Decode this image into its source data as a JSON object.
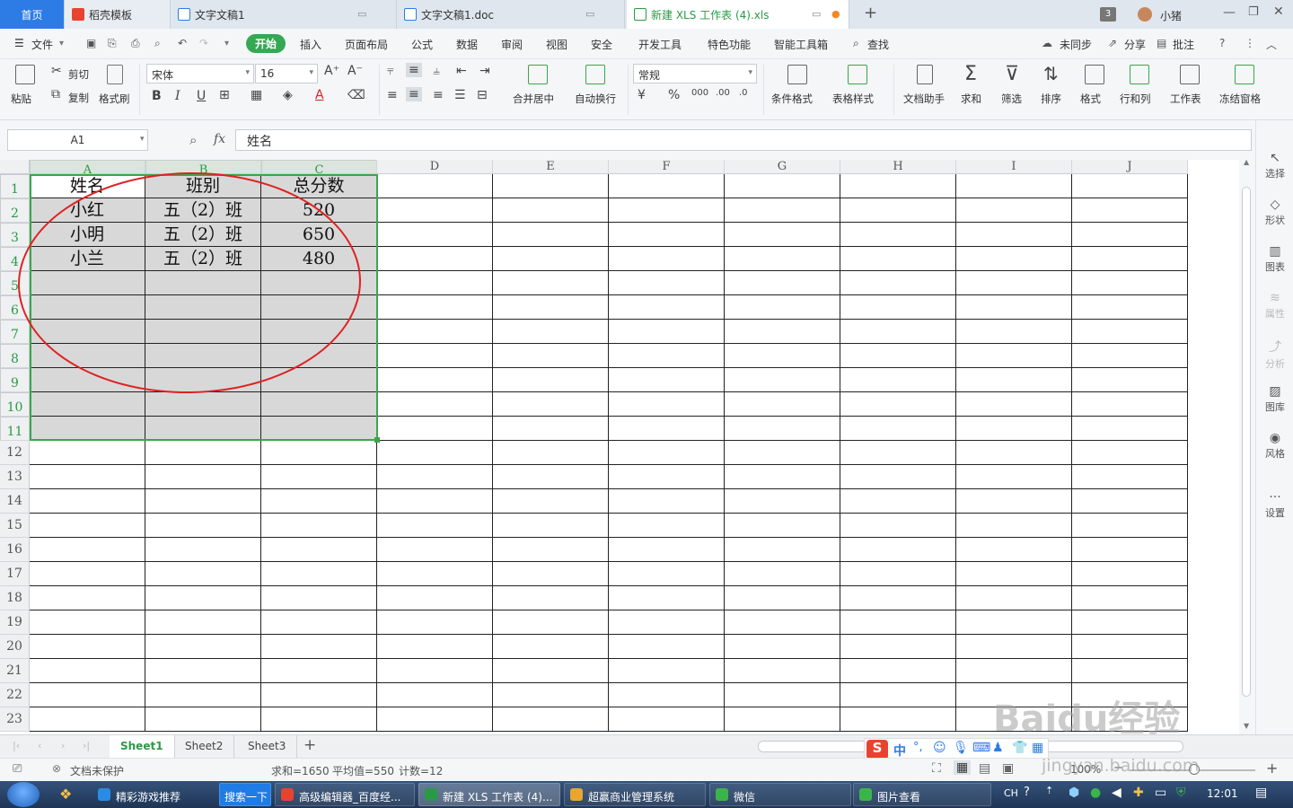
{
  "tabs": [
    {
      "label": "首页"
    },
    {
      "label": "稻壳模板"
    },
    {
      "label": "文字文稿1"
    },
    {
      "label": "文字文稿1.doc"
    },
    {
      "label": "新建 XLS 工作表 (4).xls"
    }
  ],
  "window": {
    "badge": "3",
    "user": "小猪"
  },
  "menu": [
    "文件",
    "开始",
    "插入",
    "页面布局",
    "公式",
    "数据",
    "审阅",
    "视图",
    "安全",
    "开发工具",
    "特色功能",
    "智能工具箱",
    "查找"
  ],
  "menu_right": [
    "未同步",
    "分享",
    "批注"
  ],
  "ribbon": {
    "paste": "粘贴",
    "cut": "剪切",
    "copy": "复制",
    "format_painter": "格式刷",
    "font_name": "宋体",
    "font_size": "16",
    "merge_center": "合并居中",
    "wrap": "自动换行",
    "number_format": "常规",
    "cond_format": "条件格式",
    "table_style": "表格样式",
    "doc_assist": "文档助手",
    "sum": "求和",
    "filter": "筛选",
    "sort": "排序",
    "format": "格式",
    "rows_cols": "行和列",
    "worksheet": "工作表",
    "freeze": "冻结窗格"
  },
  "formula": {
    "cell_ref": "A1",
    "fx": "fx",
    "value": "姓名"
  },
  "columns": [
    "A",
    "B",
    "C",
    "D",
    "E",
    "F",
    "G",
    "H",
    "I",
    "J"
  ],
  "rows": [
    "1",
    "2",
    "3",
    "4",
    "5",
    "6",
    "7",
    "8",
    "9",
    "10",
    "11",
    "12",
    "13",
    "14",
    "15",
    "16",
    "17",
    "18",
    "19",
    "20",
    "21",
    "22",
    "23"
  ],
  "table": [
    [
      "姓名",
      "班别",
      "总分数"
    ],
    [
      "小红",
      "五（2）班",
      "520"
    ],
    [
      "小明",
      "五（2）班",
      "650"
    ],
    [
      "小兰",
      "五（2）班",
      "480"
    ]
  ],
  "right_panel": [
    "选择",
    "形状",
    "图表",
    "属性",
    "分析",
    "图库",
    "风格",
    "设置"
  ],
  "sheets": [
    "Sheet1",
    "Sheet2",
    "Sheet3"
  ],
  "status": {
    "protect": "文档未保护",
    "sum": "求和=1650",
    "avg": "平均值=550",
    "count": "计数=12",
    "zoom": "100%"
  },
  "taskbar": {
    "items": [
      "精彩游戏推荐",
      "搜索一下",
      "高级编辑器_百度经...",
      "新建 XLS 工作表 (4)...",
      "超赢商业管理系统",
      "微信",
      "图片查看"
    ],
    "lang": "CH",
    "clock": "12:01"
  },
  "ime": "中",
  "watermark": [
    "Baidu经验",
    "jingyan.baidu.com"
  ]
}
